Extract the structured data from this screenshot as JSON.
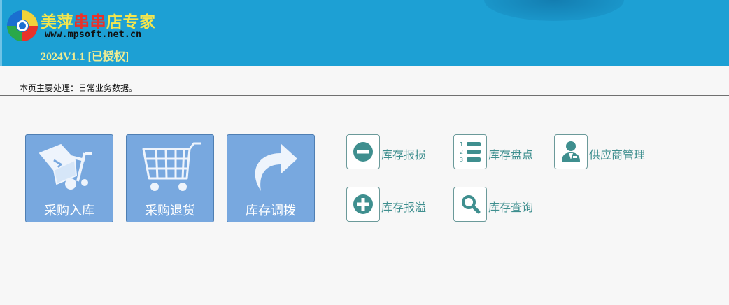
{
  "header": {
    "title_part1": "美萍",
    "title_part2": "串串",
    "title_part3": "店专家",
    "url": "www.mpsoft.net.cn",
    "version": "2024V1.1 [已授权]"
  },
  "page": {
    "description": "本页主要处理：日常业务数据。"
  },
  "main_buttons": [
    {
      "label": "采购入库",
      "icon": "dolly-box-icon"
    },
    {
      "label": "采购退货",
      "icon": "shopping-cart-icon"
    },
    {
      "label": "库存调拨",
      "icon": "curved-arrow-icon"
    }
  ],
  "small_buttons": [
    {
      "label": "库存报损",
      "icon": "minus-circle-icon"
    },
    {
      "label": "库存盘点",
      "icon": "numbered-list-icon"
    },
    {
      "label": "供应商管理",
      "icon": "user-tie-icon"
    },
    {
      "label": "库存报溢",
      "icon": "plus-circle-icon"
    },
    {
      "label": "库存查询",
      "icon": "magnifier-icon"
    }
  ],
  "colors": {
    "header_bg": "#1da0d4",
    "tile_bg": "#78a8df",
    "accent_teal": "#3f8f8f"
  }
}
